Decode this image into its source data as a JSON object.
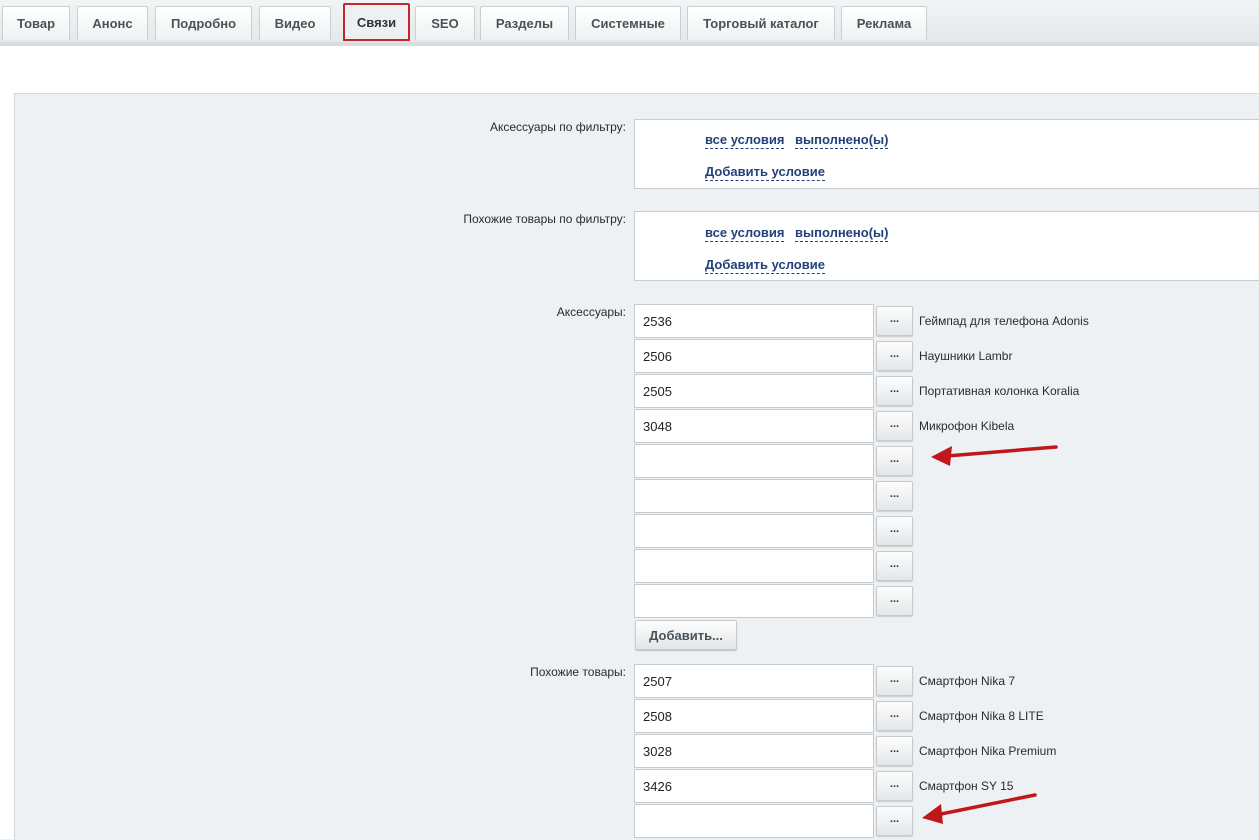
{
  "tabs": [
    {
      "label": "Товар"
    },
    {
      "label": "Анонс"
    },
    {
      "label": "Подробно"
    },
    {
      "label": "Видео"
    },
    {
      "label": "Связи"
    },
    {
      "label": "SEO"
    },
    {
      "label": "Разделы"
    },
    {
      "label": "Системные"
    },
    {
      "label": "Торговый каталог"
    },
    {
      "label": "Реклама"
    }
  ],
  "filters": {
    "accessories": {
      "label": "Аксессуары по фильтру:",
      "cond_all": "все условия",
      "cond_met": "выполнено(ы)",
      "add": "Добавить условие"
    },
    "similar": {
      "label": "Похожие товары по фильтру:",
      "cond_all": "все условия",
      "cond_met": "выполнено(ы)",
      "add": "Добавить условие"
    }
  },
  "accessories": {
    "label": "Аксессуары:",
    "browse_label": "...",
    "add_label": "Добавить...",
    "items": [
      {
        "id": "2536",
        "name": "Геймпад для телефона Adonis"
      },
      {
        "id": "2506",
        "name": "Наушники Lambr"
      },
      {
        "id": "2505",
        "name": "Портативная колонка Koralia"
      },
      {
        "id": "3048",
        "name": "Микрофон Kibela"
      },
      {
        "id": "",
        "name": ""
      },
      {
        "id": "",
        "name": ""
      },
      {
        "id": "",
        "name": ""
      },
      {
        "id": "",
        "name": ""
      },
      {
        "id": "",
        "name": ""
      }
    ]
  },
  "similar": {
    "label": "Похожие товары:",
    "browse_label": "...",
    "items": [
      {
        "id": "2507",
        "name": "Смартфон Nika 7"
      },
      {
        "id": "2508",
        "name": "Смартфон Nika 8 LITE"
      },
      {
        "id": "3028",
        "name": "Смартфон Nika Premium"
      },
      {
        "id": "3426",
        "name": "Смартфон SY 15"
      },
      {
        "id": "",
        "name": ""
      }
    ]
  },
  "colors": {
    "active_tab_border": "#c3262b",
    "link": "#23427a",
    "arrow": "#c0171b"
  }
}
